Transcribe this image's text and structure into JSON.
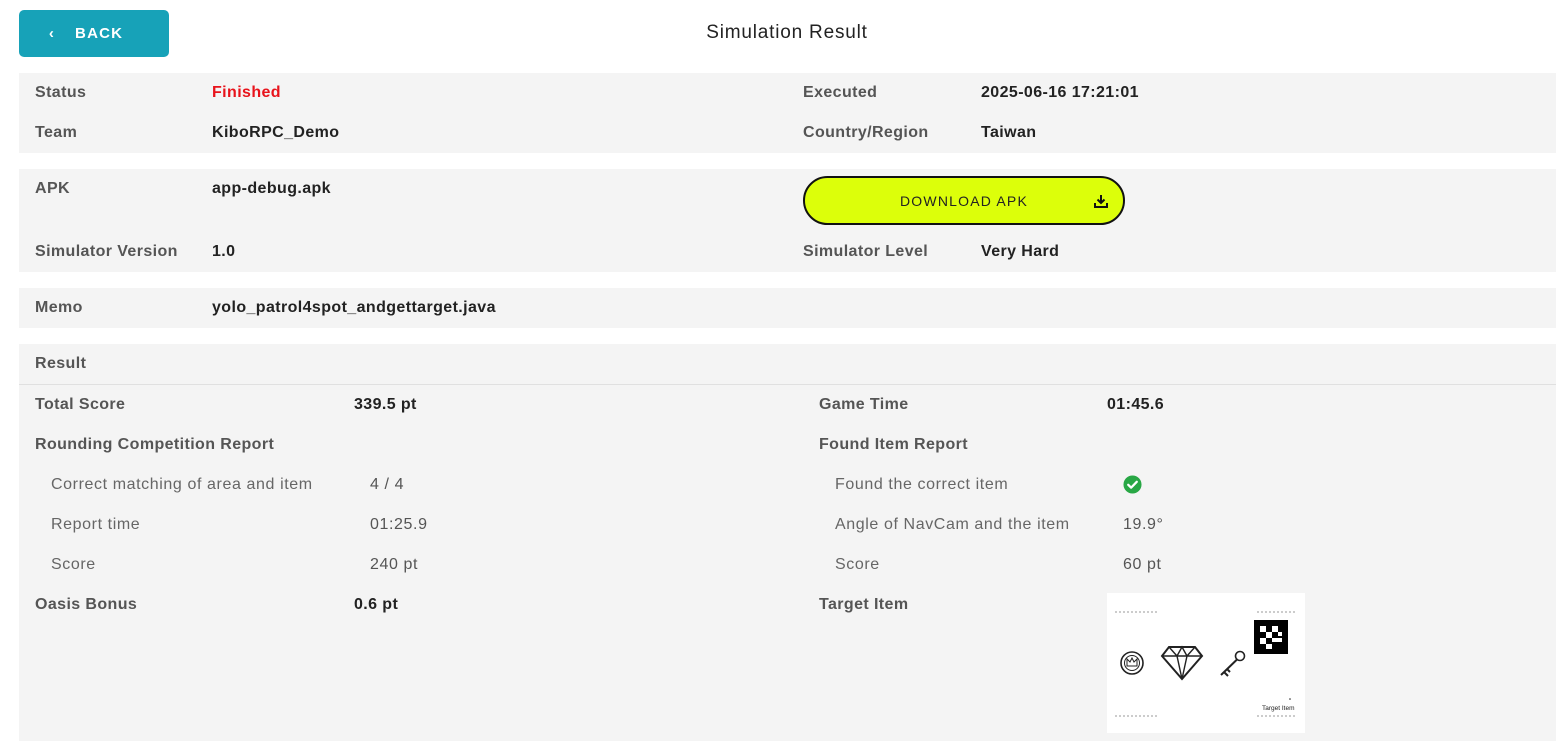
{
  "header": {
    "back_label": "BACK",
    "title": "Simulation Result"
  },
  "summary": {
    "status_label": "Status",
    "status_value": "Finished",
    "status_color": "#e8131b",
    "executed_label": "Executed",
    "executed_value": "2025-06-16 17:21:01",
    "team_label": "Team",
    "team_value": "KiboRPC_Demo",
    "country_label": "Country/Region",
    "country_value": "Taiwan"
  },
  "apk": {
    "apk_label": "APK",
    "apk_value": "app-debug.apk",
    "download_label": "DOWNLOAD APK",
    "download_color": "#dcff0a",
    "version_label": "Simulator Version",
    "version_value": "1.0",
    "level_label": "Simulator Level",
    "level_value": "Very Hard"
  },
  "memo": {
    "label": "Memo",
    "value": "yolo_patrol4spot_andgettarget.java"
  },
  "result": {
    "heading": "Result",
    "total_score_label": "Total Score",
    "total_score_value": "339.5 pt",
    "game_time_label": "Game Time",
    "game_time_value": "01:45.6",
    "rounding_heading": "Rounding Competition Report",
    "found_heading": "Found Item Report",
    "rounding": {
      "matching_label": "Correct matching of area and item",
      "matching_value": "4 / 4",
      "report_time_label": "Report time",
      "report_time_value": "01:25.9",
      "score_label": "Score",
      "score_value": "240 pt"
    },
    "found": {
      "correct_label": "Found the correct item",
      "correct_icon": "check-circle-icon",
      "correct_color": "#28a745",
      "angle_label": "Angle of NavCam and the item",
      "angle_value": "19.9°",
      "score_label": "Score",
      "score_value": "60 pt"
    },
    "oasis_label": "Oasis Bonus",
    "oasis_value": "0.6 pt",
    "target_item_label": "Target Item",
    "target_image": {
      "caption": "Target Item",
      "icons": [
        "crown-coin-icon",
        "diamond-icon",
        "key-icon",
        "qr-marker-icon"
      ]
    }
  }
}
